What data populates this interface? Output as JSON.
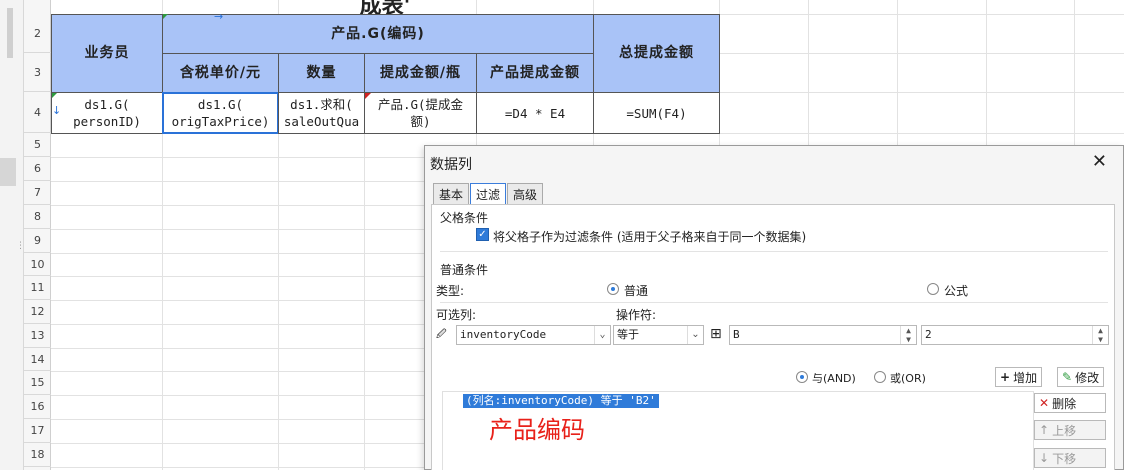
{
  "sheet": {
    "title_partial": "成表'",
    "rows": [
      "2",
      "3",
      "4",
      "5",
      "6",
      "7",
      "8",
      "9",
      "10",
      "11",
      "12",
      "13",
      "14",
      "15",
      "16",
      "17",
      "18"
    ],
    "headers": {
      "salesman": "业务员",
      "product_group": "产品.G(编码)",
      "unit_price": "含税单价/元",
      "quantity": "数量",
      "comm_per_bottle": "提成金额/瓶",
      "product_comm": "产品提成金额",
      "total_comm": "总提成金额"
    },
    "row4": {
      "salesman": "ds1.G(\npersonID)",
      "unit_price": "ds1.G(\norigTaxPrice)",
      "quantity": "ds1.求和(\nsaleOutQua",
      "comm_per_bottle": "产品.G(提成金\n额)",
      "product_comm": "=D4 * E4",
      "total_comm": "=SUM(F4)"
    },
    "header_color": "#a9c3f7"
  },
  "dialog": {
    "title": "数据列",
    "close": "✕",
    "tabs": [
      "基本",
      "过滤",
      "高级"
    ],
    "active_tab": 1,
    "parent_section": "父格条件",
    "parent_checkbox": "将父格子作为过滤条件 (适用于父子格来自于同一个数据集)",
    "normal_section": "普通条件",
    "type_label": "类型:",
    "type_normal": "普通",
    "type_formula": "公式",
    "column_label": "可选列:",
    "operator_label": "操作符:",
    "column_value": "inventoryCode",
    "operator_value": "等于",
    "value_b": "B",
    "value_2": "2",
    "and_label": "与(AND)",
    "or_label": "或(OR)",
    "add_button": "增加",
    "modify_button": "修改",
    "delete_button": "删除",
    "up_button": "上移",
    "down_button": "下移",
    "condition_item": "(列名:inventoryCode) 等于 'B2'",
    "annotation": "产品编码",
    "accent": "#2f7bd9",
    "annotation_color": "#e8211a"
  }
}
